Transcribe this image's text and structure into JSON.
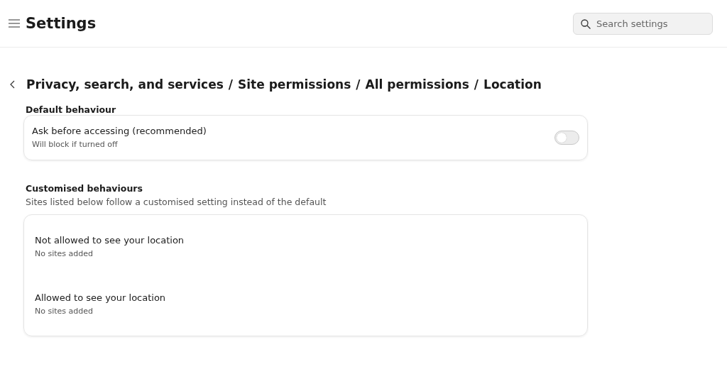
{
  "header": {
    "title": "Settings",
    "search": {
      "placeholder": "Search settings"
    }
  },
  "breadcrumb": {
    "items": [
      "Privacy, search, and services",
      "Site permissions",
      "All permissions",
      "Location"
    ],
    "separator": "/"
  },
  "default_behaviour": {
    "heading": "Default behaviour",
    "setting": {
      "label": "Ask before accessing (recommended)",
      "description": "Will block if turned off",
      "on": false
    }
  },
  "customised_behaviours": {
    "heading": "Customised behaviours",
    "description": "Sites listed below follow a customised setting instead of the default",
    "lists": [
      {
        "title": "Not allowed to see your location",
        "status": "No sites added"
      },
      {
        "title": "Allowed to see your location",
        "status": "No sites added"
      }
    ]
  }
}
